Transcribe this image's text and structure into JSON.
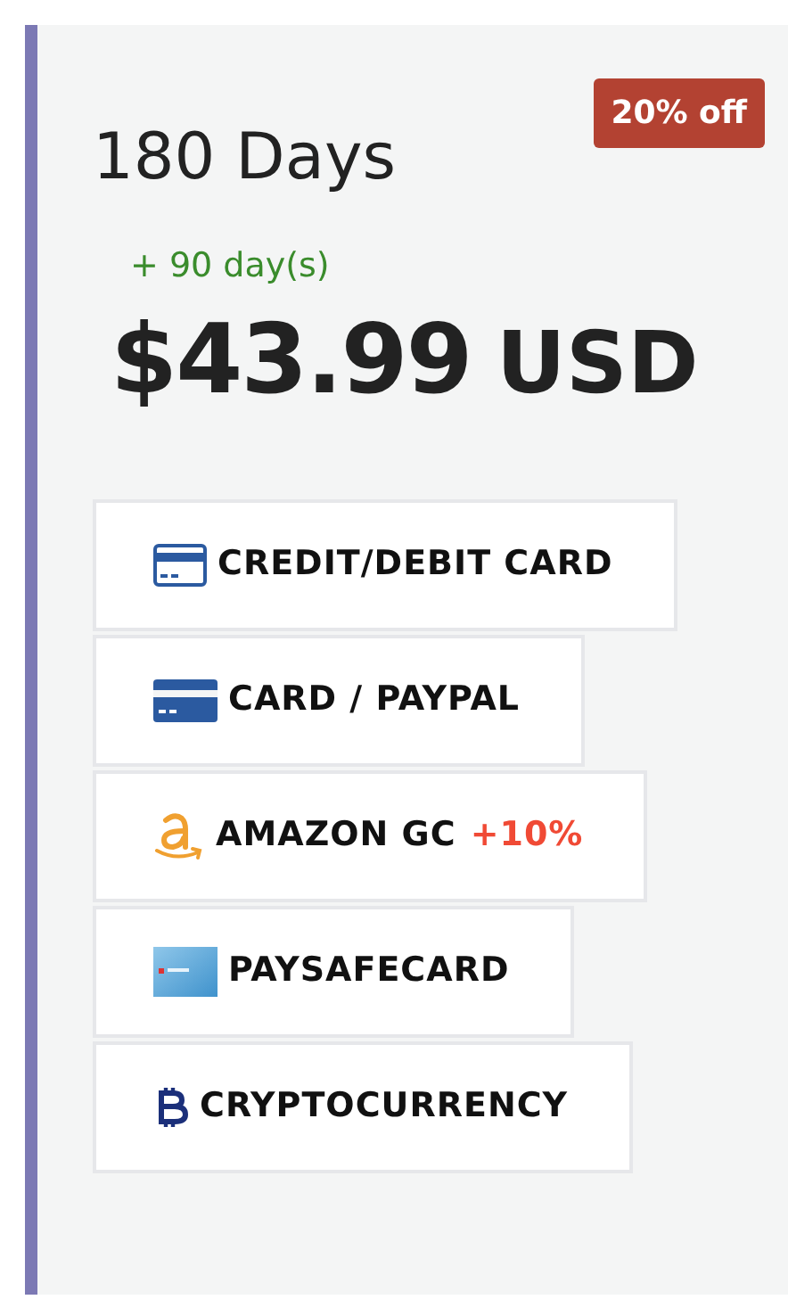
{
  "plan": {
    "title": "180 Days",
    "discount_badge": "20% off",
    "bonus": "+ 90 day(s)",
    "price": "$43.99",
    "currency": "USD"
  },
  "payment_methods": [
    {
      "kind": "card-outline",
      "label": "CREDIT/DEBIT CARD"
    },
    {
      "kind": "card-solid",
      "label": "CARD / PAYPAL"
    },
    {
      "kind": "amazon",
      "label": "AMAZON GC",
      "bonus": "+10%"
    },
    {
      "kind": "paysafe",
      "label": "PAYSAFECARD"
    },
    {
      "kind": "bitcoin",
      "label": "CRYPTOCURRENCY"
    }
  ]
}
